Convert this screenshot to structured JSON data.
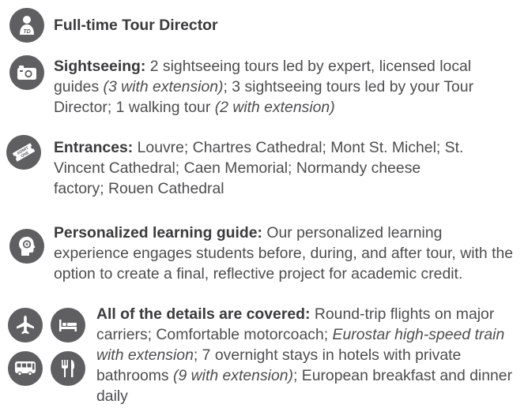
{
  "items": [
    {
      "icon": "tour-director-icon",
      "icon_text": "TD",
      "label": "Full-time Tour Director",
      "segments": []
    },
    {
      "icon": "camera-icon",
      "label": "Sightseeing:",
      "segments": [
        {
          "t": " 2 sightseeing tours led by expert, licensed local guides ",
          "i": false
        },
        {
          "t": "(3 with extension)",
          "i": true
        },
        {
          "t": "; 3 sightseeing tours led by your Tour Director; 1 walking tour ",
          "i": false
        },
        {
          "t": "(2 with extension)",
          "i": true
        }
      ]
    },
    {
      "icon": "admission-ticket-icon",
      "icon_text": "ADMIT ONE",
      "label": "Entrances:",
      "segments": [
        {
          "t": " Louvre; Chartres Cathedral; Mont St. Michel; St. Vincent Cathedral; Caen Memorial; Normandy cheese factory; Rouen Cathedral",
          "i": false
        }
      ]
    },
    {
      "icon": "learning-head-icon",
      "label": "Personalized learning guide:",
      "segments": [
        {
          "t": " Our personalized learning experience engages students before, during, and after tour, with the option to create a final, reflective project for academic credit.",
          "i": false
        }
      ]
    },
    {
      "icons": [
        "airplane-icon",
        "bed-icon",
        "bus-icon",
        "utensils-icon"
      ],
      "label": "All of the details are covered:",
      "segments": [
        {
          "t": " Round-trip flights on major carriers; Comfortable motorcoach; ",
          "i": false
        },
        {
          "t": "Eurostar high-speed train with extension",
          "i": true
        },
        {
          "t": "; 7 overnight stays in hotels with private bathrooms ",
          "i": false
        },
        {
          "t": "(9 with extension)",
          "i": true
        },
        {
          "t": "; European breakfast and dinner daily",
          "i": false
        }
      ]
    }
  ]
}
